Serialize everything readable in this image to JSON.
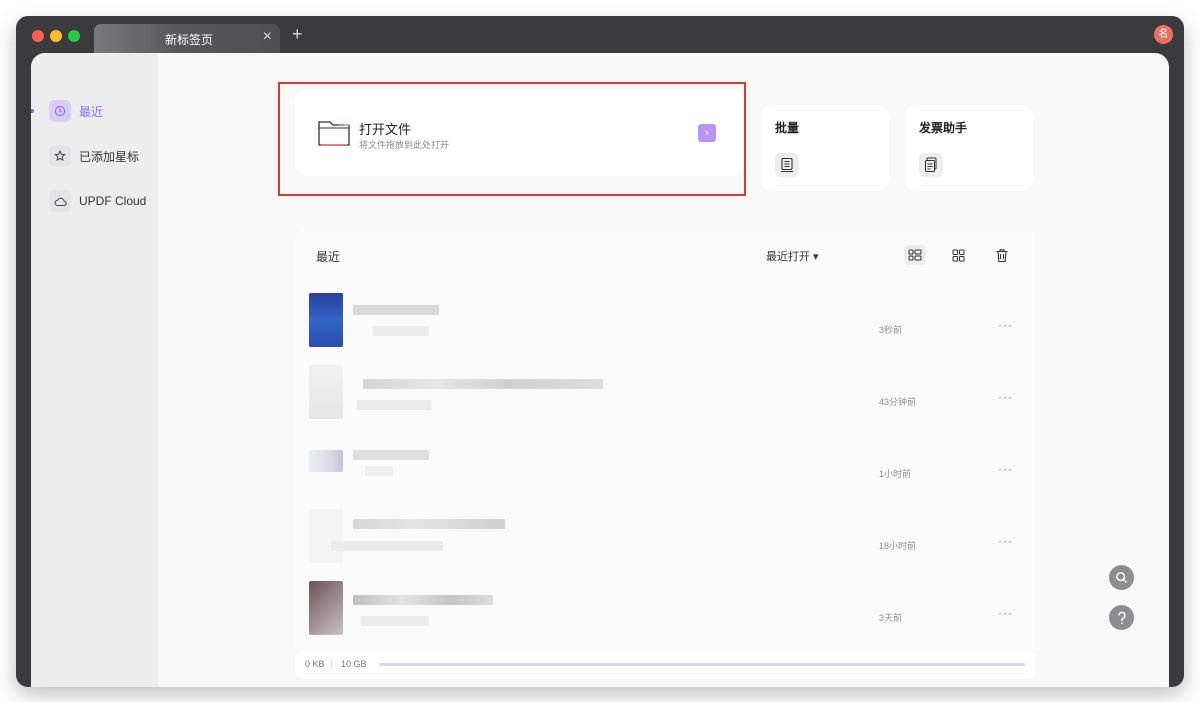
{
  "tab": {
    "title": "新标签页",
    "close": "×",
    "new_tab": "+"
  },
  "avatar": {
    "initial": "名"
  },
  "sidebar": {
    "items": [
      {
        "label": "最近",
        "icon": "clock-icon",
        "active": true
      },
      {
        "label": "已添加星标",
        "icon": "star-icon",
        "active": false
      },
      {
        "label": "UPDF Cloud",
        "icon": "cloud-icon",
        "active": false
      }
    ]
  },
  "open_card": {
    "title": "打开文件",
    "subtitle": "将文件拖放到此处打开",
    "arrow": "›"
  },
  "quick_cards": {
    "batch": {
      "title": "批量",
      "icon": "batch-document-icon"
    },
    "invoice": {
      "title": "发票助手",
      "icon": "invoice-icon"
    }
  },
  "recent": {
    "title": "最近",
    "sort_label": "最近打开 ▾",
    "files": [
      {
        "time": "3秒前",
        "thumb_color": "#2d56b6"
      },
      {
        "time": "43分钟前",
        "thumb_color": "#e9e9ea"
      },
      {
        "time": "1小时前",
        "thumb_color": "#e9e9ef"
      },
      {
        "time": "18小时前",
        "thumb_color": "#f4f4f4"
      },
      {
        "time": "3天前",
        "thumb_color": "#7a6b70"
      }
    ],
    "more_label": "···"
  },
  "storage": {
    "used": "0 KB",
    "total": "10 GB"
  },
  "colors": {
    "accent": "#8e70f4",
    "highlight_border": "#d6392f"
  }
}
